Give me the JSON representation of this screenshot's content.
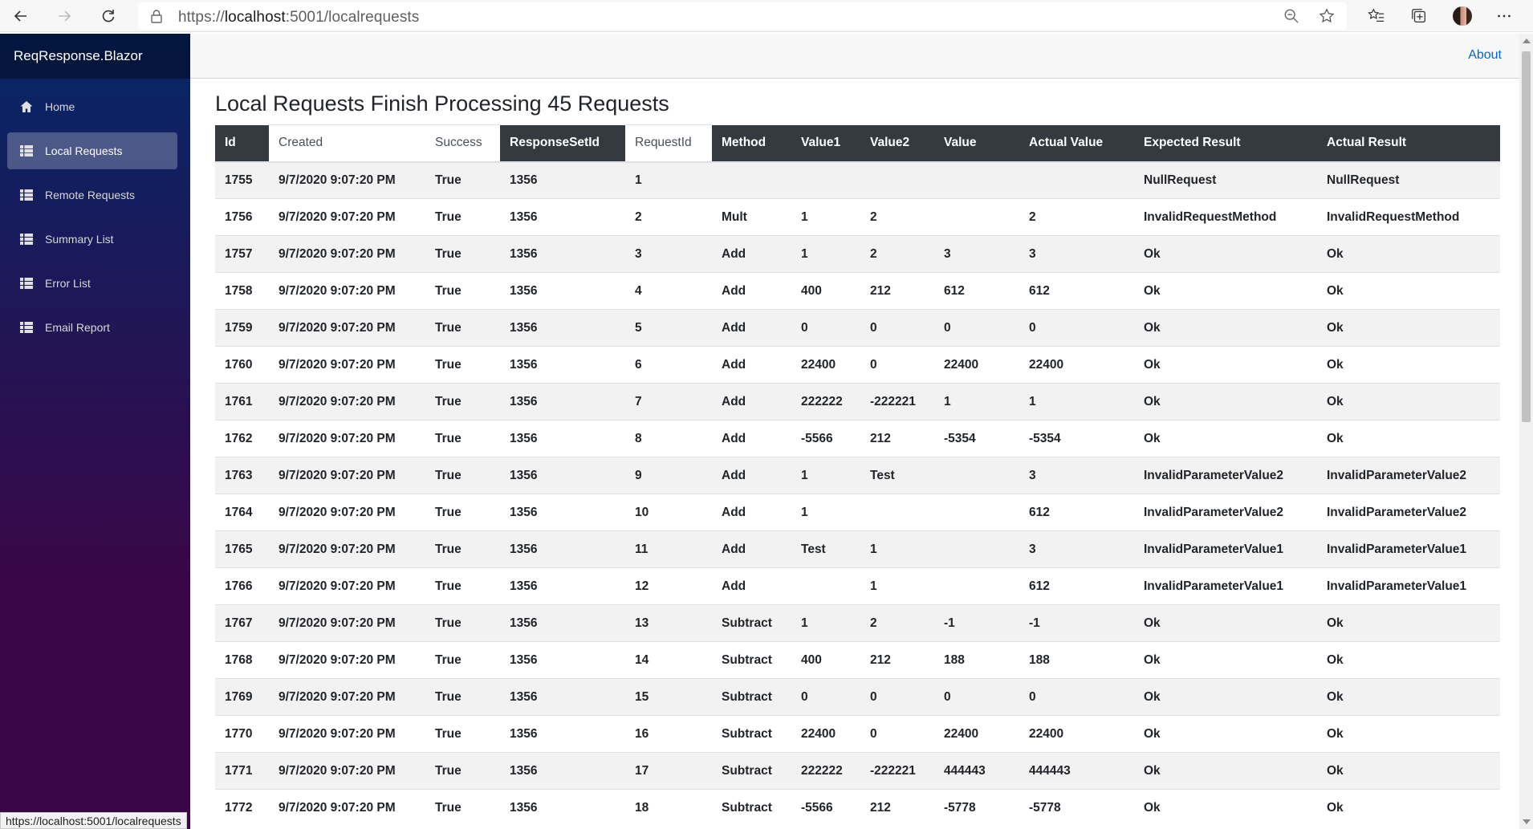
{
  "browser": {
    "url_prefix": "https://",
    "url_host": "localhost",
    "url_rest": ":5001/localrequests"
  },
  "sidebar": {
    "brand": "ReqResponse.Blazor",
    "items": [
      {
        "label": "Home",
        "icon": "home-icon"
      },
      {
        "label": "Local Requests",
        "icon": "list-icon"
      },
      {
        "label": "Remote Requests",
        "icon": "list-icon"
      },
      {
        "label": "Summary List",
        "icon": "list-icon"
      },
      {
        "label": "Error List",
        "icon": "list-icon"
      },
      {
        "label": "Email Report",
        "icon": "list-icon"
      }
    ]
  },
  "header": {
    "about": "About"
  },
  "page": {
    "title": "Local Requests Finish Processing 45 Requests"
  },
  "table": {
    "headers": [
      "Id",
      "Created",
      "Success",
      "ResponseSetId",
      "RequestId",
      "Method",
      "Value1",
      "Value2",
      "Value",
      "Actual Value",
      "Expected Result",
      "Actual Result"
    ],
    "rows": [
      [
        "1755",
        "9/7/2020 9:07:20 PM",
        "True",
        "1356",
        "1",
        "",
        "",
        "",
        "",
        "",
        "NullRequest",
        "NullRequest"
      ],
      [
        "1756",
        "9/7/2020 9:07:20 PM",
        "True",
        "1356",
        "2",
        "Mult",
        "1",
        "2",
        "",
        "2",
        "InvalidRequestMethod",
        "InvalidRequestMethod"
      ],
      [
        "1757",
        "9/7/2020 9:07:20 PM",
        "True",
        "1356",
        "3",
        "Add",
        "1",
        "2",
        "3",
        "3",
        "Ok",
        "Ok"
      ],
      [
        "1758",
        "9/7/2020 9:07:20 PM",
        "True",
        "1356",
        "4",
        "Add",
        "400",
        "212",
        "612",
        "612",
        "Ok",
        "Ok"
      ],
      [
        "1759",
        "9/7/2020 9:07:20 PM",
        "True",
        "1356",
        "5",
        "Add",
        "0",
        "0",
        "0",
        "0",
        "Ok",
        "Ok"
      ],
      [
        "1760",
        "9/7/2020 9:07:20 PM",
        "True",
        "1356",
        "6",
        "Add",
        "22400",
        "0",
        "22400",
        "22400",
        "Ok",
        "Ok"
      ],
      [
        "1761",
        "9/7/2020 9:07:20 PM",
        "True",
        "1356",
        "7",
        "Add",
        "222222",
        "-222221",
        "1",
        "1",
        "Ok",
        "Ok"
      ],
      [
        "1762",
        "9/7/2020 9:07:20 PM",
        "True",
        "1356",
        "8",
        "Add",
        "-5566",
        "212",
        "-5354",
        "-5354",
        "Ok",
        "Ok"
      ],
      [
        "1763",
        "9/7/2020 9:07:20 PM",
        "True",
        "1356",
        "9",
        "Add",
        "1",
        "Test",
        "",
        "3",
        "InvalidParameterValue2",
        "InvalidParameterValue2"
      ],
      [
        "1764",
        "9/7/2020 9:07:20 PM",
        "True",
        "1356",
        "10",
        "Add",
        "1",
        "",
        "",
        "612",
        "InvalidParameterValue2",
        "InvalidParameterValue2"
      ],
      [
        "1765",
        "9/7/2020 9:07:20 PM",
        "True",
        "1356",
        "11",
        "Add",
        "Test",
        "1",
        "",
        "3",
        "InvalidParameterValue1",
        "InvalidParameterValue1"
      ],
      [
        "1766",
        "9/7/2020 9:07:20 PM",
        "True",
        "1356",
        "12",
        "Add",
        "",
        "1",
        "",
        "612",
        "InvalidParameterValue1",
        "InvalidParameterValue1"
      ],
      [
        "1767",
        "9/7/2020 9:07:20 PM",
        "True",
        "1356",
        "13",
        "Subtract",
        "1",
        "2",
        "-1",
        "-1",
        "Ok",
        "Ok"
      ],
      [
        "1768",
        "9/7/2020 9:07:20 PM",
        "True",
        "1356",
        "14",
        "Subtract",
        "400",
        "212",
        "188",
        "188",
        "Ok",
        "Ok"
      ],
      [
        "1769",
        "9/7/2020 9:07:20 PM",
        "True",
        "1356",
        "15",
        "Subtract",
        "0",
        "0",
        "0",
        "0",
        "Ok",
        "Ok"
      ],
      [
        "1770",
        "9/7/2020 9:07:20 PM",
        "True",
        "1356",
        "16",
        "Subtract",
        "22400",
        "0",
        "22400",
        "22400",
        "Ok",
        "Ok"
      ],
      [
        "1771",
        "9/7/2020 9:07:20 PM",
        "True",
        "1356",
        "17",
        "Subtract",
        "222222",
        "-222221",
        "444443",
        "444443",
        "Ok",
        "Ok"
      ],
      [
        "1772",
        "9/7/2020 9:07:20 PM",
        "True",
        "1356",
        "18",
        "Subtract",
        "-5566",
        "212",
        "-5778",
        "-5778",
        "Ok",
        "Ok"
      ]
    ]
  },
  "status_bar": {
    "hover_url": "https://localhost:5001/localrequests"
  }
}
